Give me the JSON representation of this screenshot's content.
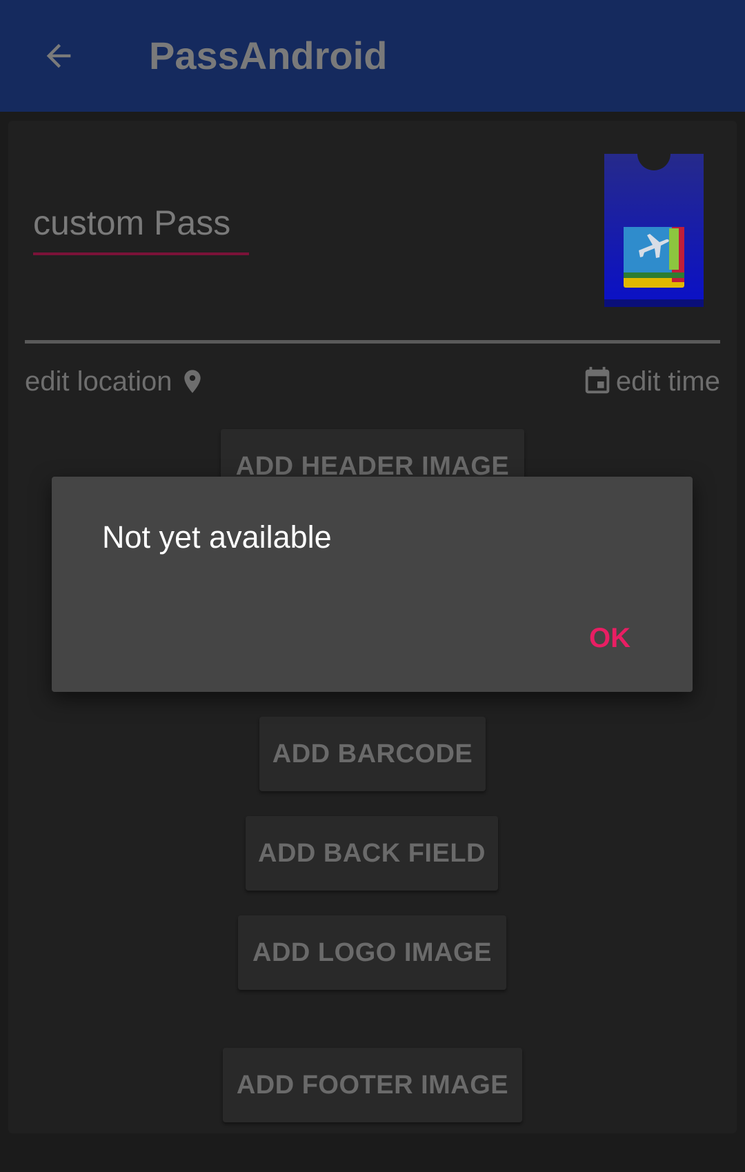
{
  "toolbar": {
    "title": "PassAndroid",
    "back_icon": "arrow-left-icon",
    "background": "#152a5e"
  },
  "pass": {
    "title": "custom Pass",
    "icon": "pass-ticket-icon"
  },
  "meta": {
    "location_label": "edit location",
    "location_icon": "map-pin-icon",
    "time_label": "edit time",
    "time_icon": "calendar-icon"
  },
  "buttons": {
    "add_header_image": "ADD HEADER IMAGE",
    "add_barcode": "ADD BARCODE",
    "add_back_field": "ADD BACK FIELD",
    "add_logo_image": "ADD LOGO IMAGE",
    "add_footer_image": "ADD FOOTER IMAGE"
  },
  "dialog": {
    "message": "Not yet available",
    "ok_label": "OK",
    "accent": "#e91e63"
  }
}
